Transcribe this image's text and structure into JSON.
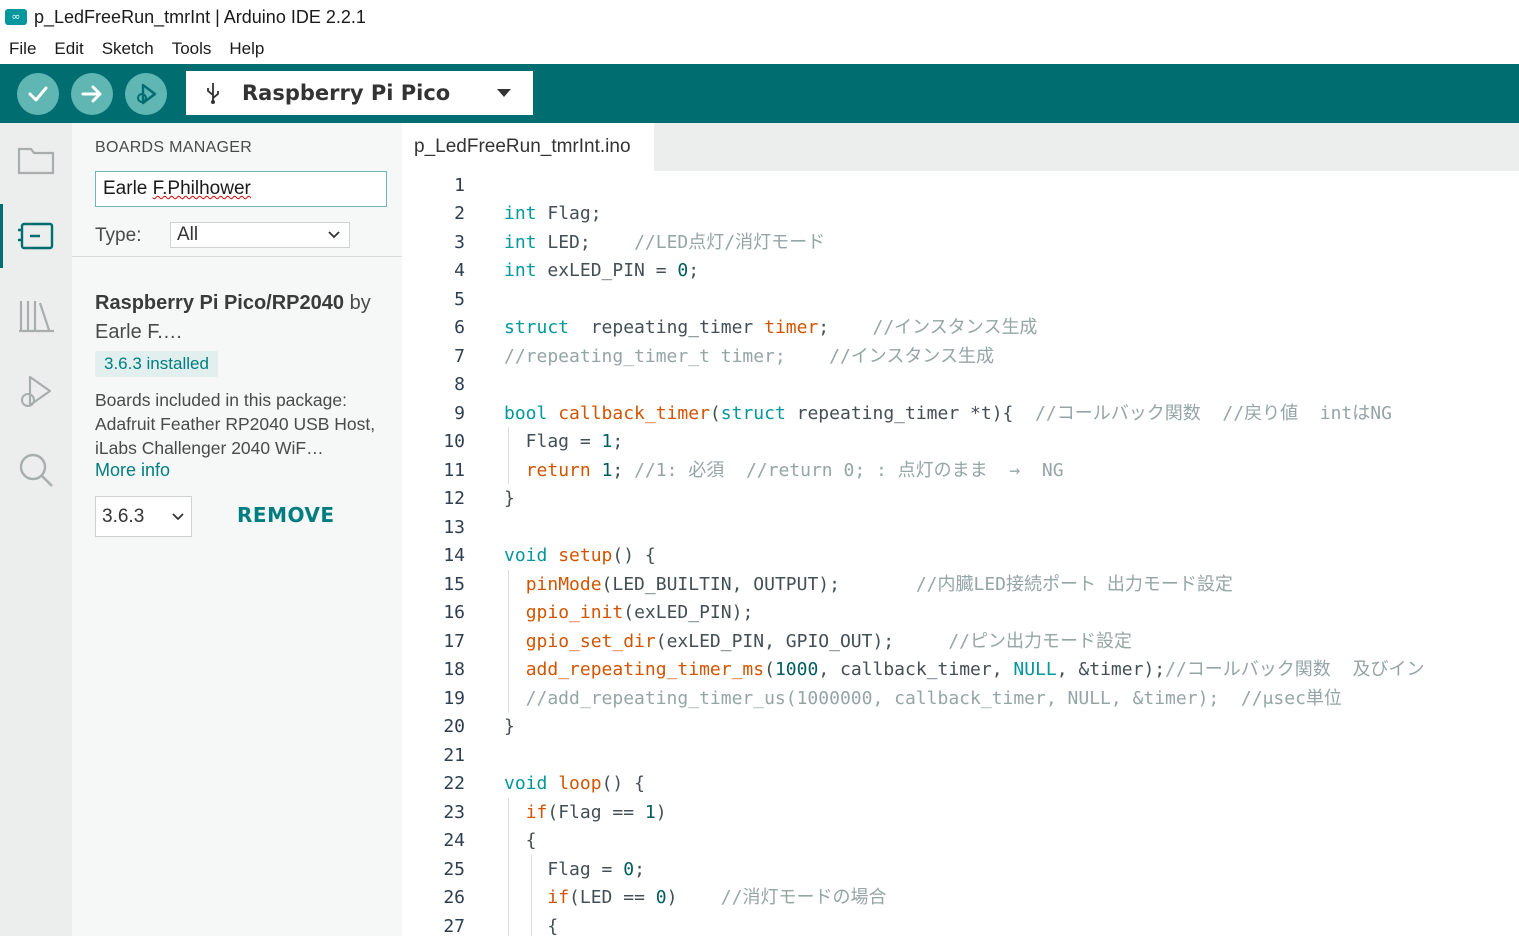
{
  "window": {
    "title": "p_LedFreeRun_tmrInt | Arduino IDE 2.2.1",
    "logo_glyph": "∞"
  },
  "menu": [
    "File",
    "Edit",
    "Sketch",
    "Tools",
    "Help"
  ],
  "toolbar": {
    "board": "Raspberry Pi Pico",
    "colors": {
      "bar": "#006d70",
      "button": "#5fb6b3"
    }
  },
  "sidebar": {
    "title": "BOARDS MANAGER",
    "search_value_plain": "Earle ",
    "search_value_marked": "F.Philhower",
    "type_label": "Type:",
    "type_value": "All",
    "board": {
      "name_bold": "Raspberry Pi Pico/RP2040",
      "by": "by Earle F.…",
      "installed": "3.6.3 installed",
      "description": "Boards included in this package: Adafruit Feather RP2040 USB Host, iLabs Challenger 2040 WiF…",
      "more_info": "More info",
      "version": "3.6.3",
      "remove": "REMOVE"
    }
  },
  "editor": {
    "tab": "p_LedFreeRun_tmrInt.ino",
    "lines": [
      {
        "n": "1",
        "t": []
      },
      {
        "n": "2",
        "t": [
          [
            "kw",
            "int"
          ],
          [
            "id",
            " Flag;"
          ]
        ]
      },
      {
        "n": "3",
        "t": [
          [
            "kw",
            "int"
          ],
          [
            "id",
            " LED;    "
          ],
          [
            "cm",
            "//LED点灯/消灯モード"
          ]
        ]
      },
      {
        "n": "4",
        "t": [
          [
            "kw",
            "int"
          ],
          [
            "id",
            " exLED_PIN = "
          ],
          [
            "num",
            "0"
          ],
          [
            "id",
            ";"
          ]
        ]
      },
      {
        "n": "5",
        "t": []
      },
      {
        "n": "6",
        "t": [
          [
            "kw",
            "struct"
          ],
          [
            "id",
            "  repeating_timer "
          ],
          [
            "fn",
            "timer"
          ],
          [
            "id",
            ";    "
          ],
          [
            "cm",
            "//インスタンス生成"
          ]
        ]
      },
      {
        "n": "7",
        "t": [
          [
            "cm",
            "//repeating_timer_t timer;    //インスタンス生成"
          ]
        ]
      },
      {
        "n": "8",
        "t": []
      },
      {
        "n": "9",
        "t": [
          [
            "kw",
            "bool"
          ],
          [
            "id",
            " "
          ],
          [
            "fn",
            "callback_timer"
          ],
          [
            "id",
            "("
          ],
          [
            "kw",
            "struct"
          ],
          [
            "id",
            " repeating_timer *t){  "
          ],
          [
            "cm",
            "//コールバック関数  //戻り値  intはNG"
          ]
        ]
      },
      {
        "n": "10",
        "t": [
          [
            "id",
            "  Flag = "
          ],
          [
            "num",
            "1"
          ],
          [
            "id",
            ";"
          ]
        ]
      },
      {
        "n": "11",
        "t": [
          [
            "id",
            "  "
          ],
          [
            "fn",
            "return"
          ],
          [
            "id",
            " "
          ],
          [
            "num",
            "1"
          ],
          [
            "id",
            "; "
          ],
          [
            "cm",
            "//1: 必須  //return 0; : 点灯のまま  →  NG"
          ]
        ]
      },
      {
        "n": "12",
        "t": [
          [
            "id",
            "}"
          ]
        ]
      },
      {
        "n": "13",
        "t": []
      },
      {
        "n": "14",
        "t": [
          [
            "kw",
            "void"
          ],
          [
            "id",
            " "
          ],
          [
            "fn",
            "setup"
          ],
          [
            "id",
            "() {"
          ]
        ]
      },
      {
        "n": "15",
        "t": [
          [
            "id",
            "  "
          ],
          [
            "fn",
            "pinMode"
          ],
          [
            "id",
            "(LED_BUILTIN, OUTPUT);       "
          ],
          [
            "cm",
            "//内臓LED接続ポート 出力モード設定"
          ]
        ]
      },
      {
        "n": "16",
        "t": [
          [
            "id",
            "  "
          ],
          [
            "fn",
            "gpio_init"
          ],
          [
            "id",
            "(exLED_PIN);"
          ]
        ]
      },
      {
        "n": "17",
        "t": [
          [
            "id",
            "  "
          ],
          [
            "fn",
            "gpio_set_dir"
          ],
          [
            "id",
            "(exLED_PIN, GPIO_OUT);     "
          ],
          [
            "cm",
            "//ピン出力モード設定"
          ]
        ]
      },
      {
        "n": "18",
        "t": [
          [
            "id",
            "  "
          ],
          [
            "fn",
            "add_repeating_timer_ms"
          ],
          [
            "id",
            "("
          ],
          [
            "num",
            "1000"
          ],
          [
            "id",
            ", callback_timer, "
          ],
          [
            "cst",
            "NULL"
          ],
          [
            "id",
            ", &timer);"
          ],
          [
            "cm",
            "//コールバック関数  及びイン"
          ]
        ]
      },
      {
        "n": "19",
        "t": [
          [
            "cm",
            "  //add_repeating_timer_us(1000000, callback_timer, NULL, &timer);  //μsec単位"
          ]
        ]
      },
      {
        "n": "20",
        "t": [
          [
            "id",
            "}"
          ]
        ]
      },
      {
        "n": "21",
        "t": []
      },
      {
        "n": "22",
        "t": [
          [
            "kw",
            "void"
          ],
          [
            "id",
            " "
          ],
          [
            "fn",
            "loop"
          ],
          [
            "id",
            "() {"
          ]
        ]
      },
      {
        "n": "23",
        "t": [
          [
            "id",
            "  "
          ],
          [
            "fn",
            "if"
          ],
          [
            "id",
            "(Flag == "
          ],
          [
            "num",
            "1"
          ],
          [
            "id",
            ")"
          ]
        ]
      },
      {
        "n": "24",
        "t": [
          [
            "id",
            "  {"
          ]
        ]
      },
      {
        "n": "25",
        "t": [
          [
            "id",
            "    Flag = "
          ],
          [
            "num",
            "0"
          ],
          [
            "id",
            ";"
          ]
        ]
      },
      {
        "n": "26",
        "t": [
          [
            "id",
            "    "
          ],
          [
            "fn",
            "if"
          ],
          [
            "id",
            "(LED == "
          ],
          [
            "num",
            "0"
          ],
          [
            "id",
            ")    "
          ],
          [
            "cm",
            "//消灯モードの場合"
          ]
        ]
      },
      {
        "n": "27",
        "t": [
          [
            "id",
            "    {"
          ]
        ]
      }
    ]
  }
}
